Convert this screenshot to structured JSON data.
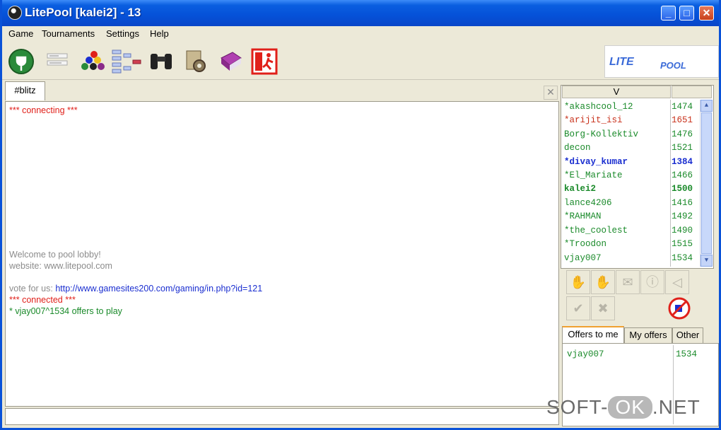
{
  "window": {
    "title": "LitePool [kalei2] - 13",
    "min": "_",
    "max": "□",
    "close": "✕"
  },
  "menu": [
    "Game",
    "Tournaments",
    "Settings",
    "Help"
  ],
  "toolbar": [
    {
      "icon": "power-plug-icon"
    },
    {
      "icon": "list-icon"
    },
    {
      "icon": "billiard-balls-icon"
    },
    {
      "icon": "tournament-tree-icon"
    },
    {
      "icon": "binoculars-icon"
    },
    {
      "icon": "settings-gear-icon"
    },
    {
      "icon": "book-icon"
    },
    {
      "icon": "exit-icon"
    }
  ],
  "logo": {
    "text1": "LITE",
    "text2": "POOL"
  },
  "tabs": {
    "active": "#blitz",
    "close": "✕"
  },
  "chat": [
    {
      "text": "*** connecting ***",
      "color": "red"
    },
    {
      "text": "Welcome to pool lobby!",
      "color": "gray"
    },
    {
      "text": "website: www.litepool.com",
      "color": "gray"
    },
    {
      "text_prefix": "vote for us: ",
      "link": "http://www.gamesites200.com/gaming/in.php?id=121",
      "color": "gray"
    },
    {
      "text": "*** connected ***",
      "color": "red"
    },
    {
      "text": "* vjay007^1534 offers to play",
      "color": "green"
    }
  ],
  "players": {
    "header_name": "V",
    "rows": [
      {
        "name": "*akashcool_12",
        "rating": "1474",
        "style": "green"
      },
      {
        "name": "*arijit_isi",
        "rating": "1651",
        "style": "red"
      },
      {
        "name": "Borg-Kollektiv",
        "rating": "1476",
        "style": "green"
      },
      {
        "name": "decon",
        "rating": "1521",
        "style": "green"
      },
      {
        "name": "*divay_kumar",
        "rating": "1384",
        "style": "blue bold"
      },
      {
        "name": "*El_Mariate",
        "rating": "1466",
        "style": "green"
      },
      {
        "name": "kalei2",
        "rating": "1500",
        "style": "green bold"
      },
      {
        "name": "lance4206",
        "rating": "1416",
        "style": "green"
      },
      {
        "name": "*RAHMAN",
        "rating": "1492",
        "style": "green"
      },
      {
        "name": "*the_coolest",
        "rating": "1490",
        "style": "green"
      },
      {
        "name": "*Troodon",
        "rating": "1515",
        "style": "green"
      },
      {
        "name": "vjay007",
        "rating": "1534",
        "style": "green"
      }
    ]
  },
  "offer_tabs": [
    "Offers to me",
    "My offers",
    "Other"
  ],
  "offers": [
    {
      "name": "vjay007",
      "rating": "1534"
    }
  ],
  "watermark": {
    "left": "SOFT-",
    "ok": "OK",
    "right": ".NET"
  }
}
